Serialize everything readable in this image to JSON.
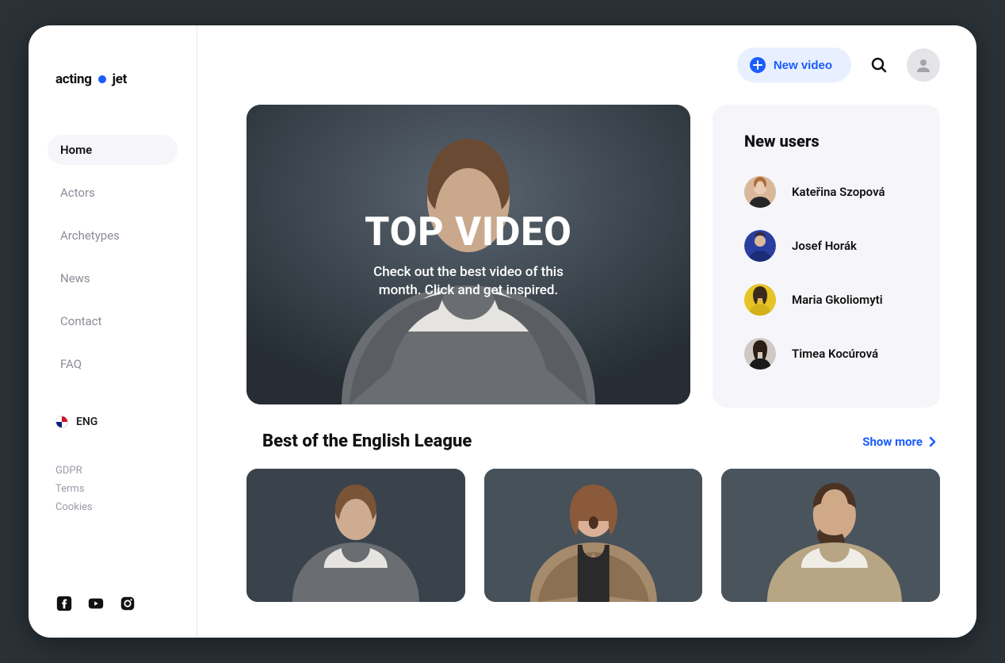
{
  "logo": {
    "part1": "acting",
    "part2": "jet"
  },
  "nav": {
    "items": [
      {
        "label": "Home",
        "active": true
      },
      {
        "label": "Actors",
        "active": false
      },
      {
        "label": "Archetypes",
        "active": false
      },
      {
        "label": "News",
        "active": false
      },
      {
        "label": "Contact",
        "active": false
      },
      {
        "label": "FAQ",
        "active": false
      }
    ]
  },
  "language": {
    "label": "ENG"
  },
  "legal": {
    "items": [
      {
        "label": "GDPR"
      },
      {
        "label": "Terms"
      },
      {
        "label": "Cookies"
      }
    ]
  },
  "topbar": {
    "new_video_label": "New video"
  },
  "hero": {
    "title": "TOP VIDEO",
    "subtitle": "Check out the best video of this month. Click and get inspired."
  },
  "new_users": {
    "title": "New users",
    "users": [
      {
        "name": "Kateřina Szopová",
        "avatar_bg": "#d9b79a"
      },
      {
        "name": "Josef Horák",
        "avatar_bg": "#2a3ea0"
      },
      {
        "name": "Maria Gkoliomyti",
        "avatar_bg": "#e6c426"
      },
      {
        "name": "Timea Kocúrová",
        "avatar_bg": "#cfc9c4"
      }
    ]
  },
  "section": {
    "title": "Best of the English League",
    "show_more": "Show more"
  },
  "videos": [
    {
      "bg": "#3a434c"
    },
    {
      "bg": "#465159"
    },
    {
      "bg": "#4a545d"
    }
  ]
}
